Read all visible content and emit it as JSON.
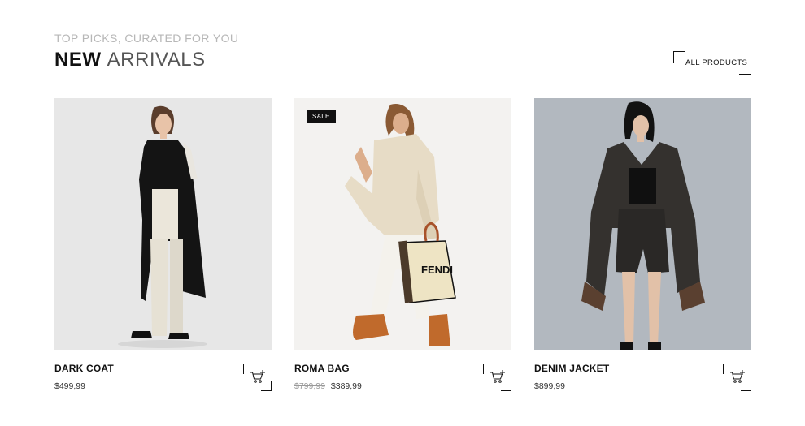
{
  "header": {
    "eyebrow": "TOP PICKS, CURATED FOR YOU",
    "title_strong": "NEW",
    "title_light": "ARRIVALS"
  },
  "all_products": {
    "label": "ALL PRODUCTS"
  },
  "products": [
    {
      "name": "DARK COAT",
      "price": "$499,99",
      "old_price": "",
      "badge": "",
      "photo_icon": "woman-black-coat-photo",
      "photo_bg": "#e7e7e7"
    },
    {
      "name": "ROMA BAG",
      "price": "$389,99",
      "old_price": "$799,99",
      "badge": "SALE",
      "photo_icon": "woman-cream-jacket-with-bag-photo",
      "photo_bg": "#f3f2f0",
      "bag_print": "FENDI"
    },
    {
      "name": "DENIM JACKET",
      "price": "$899,99",
      "old_price": "",
      "badge": "",
      "photo_icon": "woman-leather-jacket-photo",
      "photo_bg": "#b2b8bf"
    }
  ],
  "icons": {
    "cart": "add-to-cart-icon"
  }
}
